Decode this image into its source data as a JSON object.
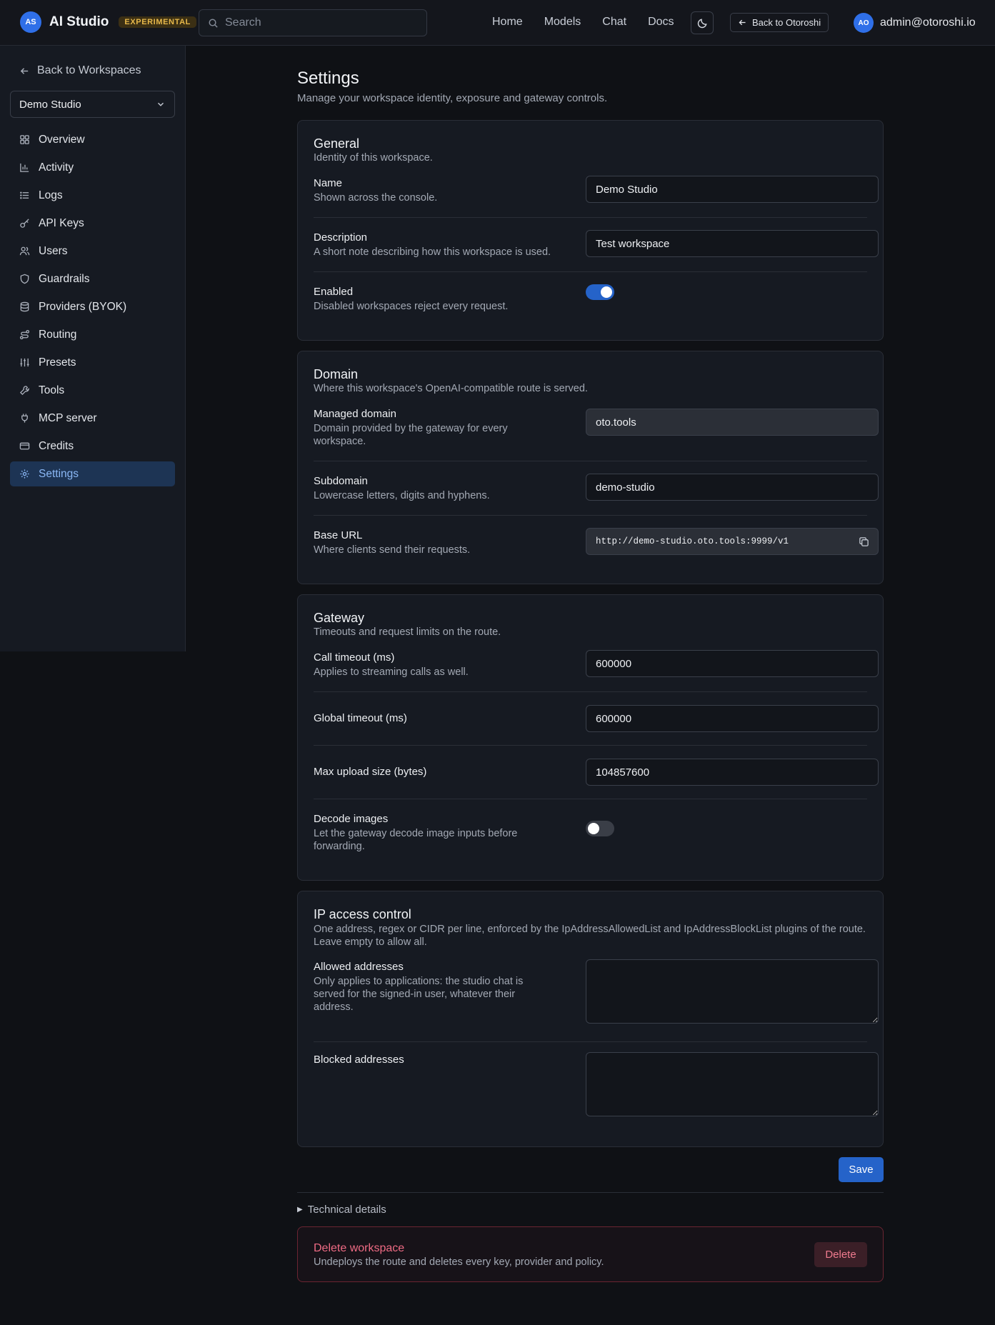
{
  "header": {
    "logo_initials": "AS",
    "app_title": "AI Studio",
    "badge": "EXPERIMENTAL",
    "search_placeholder": "Search",
    "nav": [
      "Home",
      "Models",
      "Chat",
      "Docs"
    ],
    "back_label": "Back to Otoroshi",
    "user_initials": "AO",
    "user_email": "admin@otoroshi.io"
  },
  "sidebar": {
    "back_label": "Back to Workspaces",
    "workspace_selected": "Demo Studio",
    "items": [
      {
        "label": "Overview",
        "icon": "grid-icon"
      },
      {
        "label": "Activity",
        "icon": "bar-chart-icon"
      },
      {
        "label": "Logs",
        "icon": "list-icon"
      },
      {
        "label": "API Keys",
        "icon": "key-icon"
      },
      {
        "label": "Users",
        "icon": "users-icon"
      },
      {
        "label": "Guardrails",
        "icon": "shield-icon"
      },
      {
        "label": "Providers (BYOK)",
        "icon": "database-icon"
      },
      {
        "label": "Routing",
        "icon": "route-icon"
      },
      {
        "label": "Presets",
        "icon": "sliders-icon"
      },
      {
        "label": "Tools",
        "icon": "wrench-icon"
      },
      {
        "label": "MCP server",
        "icon": "plug-icon"
      },
      {
        "label": "Credits",
        "icon": "credit-card-icon"
      },
      {
        "label": "Settings",
        "icon": "gear-icon",
        "active": true
      }
    ]
  },
  "page": {
    "title": "Settings",
    "subtitle": "Manage your workspace identity, exposure and gateway controls."
  },
  "general": {
    "title": "General",
    "subtitle": "Identity of this workspace.",
    "name_label": "Name",
    "name_desc": "Shown across the console.",
    "name_value": "Demo Studio",
    "description_label": "Description",
    "description_desc": "A short note describing how this workspace is used.",
    "description_value": "Test workspace",
    "enabled_label": "Enabled",
    "enabled_desc": "Disabled workspaces reject every request.",
    "enabled": true
  },
  "domain": {
    "title": "Domain",
    "subtitle": "Where this workspace's OpenAI-compatible route is served.",
    "managed_label": "Managed domain",
    "managed_desc": "Domain provided by the gateway for every workspace.",
    "managed_value": "oto.tools",
    "subdomain_label": "Subdomain",
    "subdomain_desc": "Lowercase letters, digits and hyphens.",
    "subdomain_value": "demo-studio",
    "base_url_label": "Base URL",
    "base_url_desc": "Where clients send their requests.",
    "base_url_value": "http://demo-studio.oto.tools:9999/v1"
  },
  "gateway": {
    "title": "Gateway",
    "subtitle": "Timeouts and request limits on the route.",
    "call_timeout_label": "Call timeout (ms)",
    "call_timeout_desc": "Applies to streaming calls as well.",
    "call_timeout_value": "600000",
    "global_timeout_label": "Global timeout (ms)",
    "global_timeout_value": "600000",
    "max_upload_label": "Max upload size (bytes)",
    "max_upload_value": "104857600",
    "decode_label": "Decode images",
    "decode_desc": "Let the gateway decode image inputs before forwarding.",
    "decode_enabled": false
  },
  "ip": {
    "title": "IP access control",
    "subtitle": "One address, regex or CIDR per line, enforced by the IpAddressAllowedList and IpAddressBlockList plugins of the route. Leave empty to allow all.",
    "allowed_label": "Allowed addresses",
    "allowed_desc": "Only applies to applications: the studio chat is served for the signed-in user, whatever their address.",
    "allowed_value": "",
    "blocked_label": "Blocked addresses",
    "blocked_value": ""
  },
  "actions": {
    "save_label": "Save",
    "technical_details": "Technical details"
  },
  "danger": {
    "title": "Delete workspace",
    "desc": "Undeploys the route and deletes every key, provider and policy.",
    "delete_label": "Delete"
  },
  "colors": {
    "accent": "#2563c9",
    "danger": "#ef6b84",
    "active_nav": "#1d3454"
  }
}
